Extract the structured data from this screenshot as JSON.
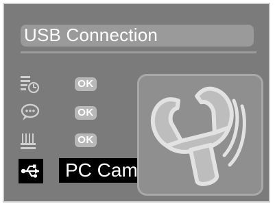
{
  "screen": {
    "title": "USB Connection"
  },
  "rows": [
    {
      "icon": "date-time-stamp-icon",
      "value": "OK"
    },
    {
      "icon": "speech-bubble-icon",
      "value": "OK"
    },
    {
      "icon": "flicker-frequency-icon",
      "value": "OK"
    }
  ],
  "selected_row": {
    "icon": "usb-icon",
    "label": "PC Cam"
  },
  "mode_panel": {
    "icon": "wrench-icon"
  },
  "colors": {
    "panel_background": "#7b7b7b",
    "pill_background": "#9a9a9a",
    "selection": "#000000",
    "text": "#ffffff"
  }
}
